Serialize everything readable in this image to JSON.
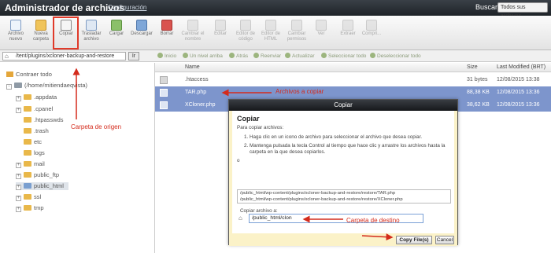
{
  "header": {
    "title": "Administrador de archivos",
    "config_link": "Configuración",
    "search_label": "Buscar",
    "search_scope": "Todos sus archivos"
  },
  "toolbar": {
    "items": [
      {
        "label": "Archivo nuevo",
        "icon": "new-file-icon",
        "enabled": true
      },
      {
        "label": "Nueva carpeta",
        "icon": "new-folder-icon",
        "enabled": true
      },
      {
        "label": "Copiar",
        "icon": "copy-icon",
        "enabled": true
      },
      {
        "label": "Trasladar archivo",
        "icon": "move-icon",
        "enabled": true
      },
      {
        "label": "Cargar",
        "icon": "upload-icon",
        "enabled": true
      },
      {
        "label": "Descargar",
        "icon": "download-icon",
        "enabled": true
      },
      {
        "label": "Borrar",
        "icon": "delete-icon",
        "enabled": true
      },
      {
        "label": "Cambiar el nombre",
        "icon": "rename-icon",
        "enabled": false
      },
      {
        "label": "Editar",
        "icon": "edit-icon",
        "enabled": false
      },
      {
        "label": "Editor de código",
        "icon": "code-editor-icon",
        "enabled": false
      },
      {
        "label": "Editor de HTML",
        "icon": "html-editor-icon",
        "enabled": false
      },
      {
        "label": "Cambiar permisos",
        "icon": "permissions-icon",
        "enabled": false
      },
      {
        "label": "Ver",
        "icon": "view-icon",
        "enabled": false
      },
      {
        "label": "Extraer",
        "icon": "extract-icon",
        "enabled": false
      },
      {
        "label": "Compri...",
        "icon": "compress-icon",
        "enabled": false
      }
    ]
  },
  "addressbar": {
    "path": "/tent/plugins/xcloner-backup-and-restore",
    "go": "Ir"
  },
  "nav": {
    "home": "Inicio",
    "up": "Un nivel arriba",
    "back": "Atrás",
    "forward": "Reenviar",
    "reload": "Actualizar",
    "select_all": "Seleccionar todo",
    "deselect_all": "Deseleccionar todo"
  },
  "tree": {
    "collapse_all": "Contraer todo",
    "root": "(/home/mitiendaeqvista)",
    "folders": [
      ".appdata",
      ".cpanel",
      ".htpasswds",
      ".trash",
      "etc",
      "logs",
      "mail",
      "public_ftp",
      "public_html",
      "ssl",
      "tmp"
    ]
  },
  "file_list": {
    "columns": {
      "name": "Name",
      "size": "Size",
      "modified": "Last Modified (BRT)"
    },
    "rows": [
      {
        "name": ".htaccess",
        "size": "31 bytes",
        "modified": "12/08/2015 13:38"
      },
      {
        "name": "TAR.php",
        "size": "88,38 KB",
        "modified": "12/08/2015 13:36"
      },
      {
        "name": "XCloner.php",
        "size": "38,62 KB",
        "modified": "12/08/2015 13:36"
      }
    ]
  },
  "dialog": {
    "title": "Copiar",
    "heading": "Copiar",
    "intro": "Para copiar archivos:",
    "step1": "Haga clic en un icono de archivo para seleccionar el archivo que desea copiar.",
    "step2": "Mantenga pulsada la tecla Control al tiempo que hace clic y arrastre los archivos hasta la carpeta en la que desea copiarlos.",
    "or": "o",
    "file1": "/public_html/wp-content/plugins/xcloner-backup-and-restore/restore/TAR.php",
    "file2": "/public_html/wp-content/plugins/xcloner-backup-and-restore/restore/XCloner.php",
    "copy_to_label": "Copiar archivo a:",
    "destination": "/public_html/clon",
    "copy_button": "Copy File(s)",
    "cancel_button": "Cancel"
  },
  "annotations": {
    "origin": "Carpeta de origen",
    "files": "Archivos a copiar",
    "destination": "Carpeta de destino"
  },
  "colors": {
    "header_bg": "#2a2f35",
    "selection": "#7d95cc",
    "annotation_red": "#d42b1c",
    "dialog_frame": "#fbf2c8"
  }
}
